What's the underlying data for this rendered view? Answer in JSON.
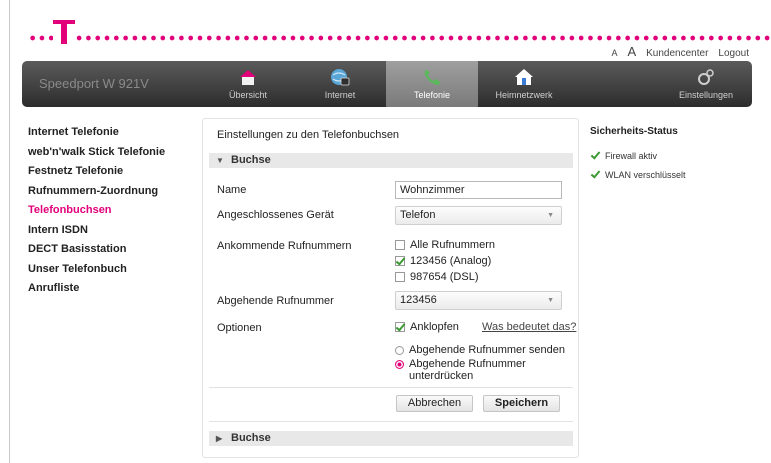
{
  "header": {
    "font_small": "A",
    "font_large": "A",
    "kundencenter": "Kundencenter",
    "logout": "Logout"
  },
  "nav": {
    "product": "Speedport W 921V",
    "tabs": [
      {
        "label": "Übersicht",
        "icon": "house-icon"
      },
      {
        "label": "Internet",
        "icon": "globe-icon"
      },
      {
        "label": "Telefonie",
        "icon": "phone-handset-icon",
        "active": true
      },
      {
        "label": "Heimnetzwerk",
        "icon": "home-network-icon"
      },
      {
        "label": "Einstellungen",
        "icon": "gears-icon"
      }
    ]
  },
  "sidebar": {
    "items": [
      {
        "label": "Internet Telefonie"
      },
      {
        "label": "web'n'walk Stick Telefonie"
      },
      {
        "label": "Festnetz Telefonie"
      },
      {
        "label": "Rufnummern-Zuordnung"
      },
      {
        "label": "Telefonbuchsen",
        "active": true
      },
      {
        "label": "Intern ISDN"
      },
      {
        "label": "DECT Basisstation"
      },
      {
        "label": "Unser Telefonbuch"
      },
      {
        "label": "Anrufliste"
      }
    ]
  },
  "main": {
    "title": "Einstellungen zu den Telefonbuchsen",
    "section1": "Buchse",
    "section2": "Buchse",
    "name_label": "Name",
    "name_value": "Wohnzimmer",
    "device_label": "Angeschlossenes Gerät",
    "device_value": "Telefon",
    "incoming_label": "Ankommende Rufnummern",
    "incoming_options": [
      {
        "label": "Alle Rufnummern",
        "checked": false
      },
      {
        "label": "123456 (Analog)",
        "checked": true
      },
      {
        "label": "987654 (DSL)",
        "checked": false
      }
    ],
    "outgoing_label": "Abgehende Rufnummer",
    "outgoing_value": "123456",
    "options_label": "Optionen",
    "anklopfen_label": "Anklopfen",
    "help_link": "Was bedeutet das?",
    "radio_send": "Abgehende Rufnummer senden",
    "radio_suppress_line1": "Abgehende Rufnummer",
    "radio_suppress_line2": "unterdrücken",
    "cancel_button": "Abbrechen",
    "save_button": "Speichern"
  },
  "status": {
    "heading": "Sicherheits-Status",
    "items": [
      "Firewall aktiv",
      "WLAN verschlüsselt"
    ]
  },
  "colors": {
    "brand_magenta": "#e2007a",
    "check_green": "#3c9a33"
  }
}
